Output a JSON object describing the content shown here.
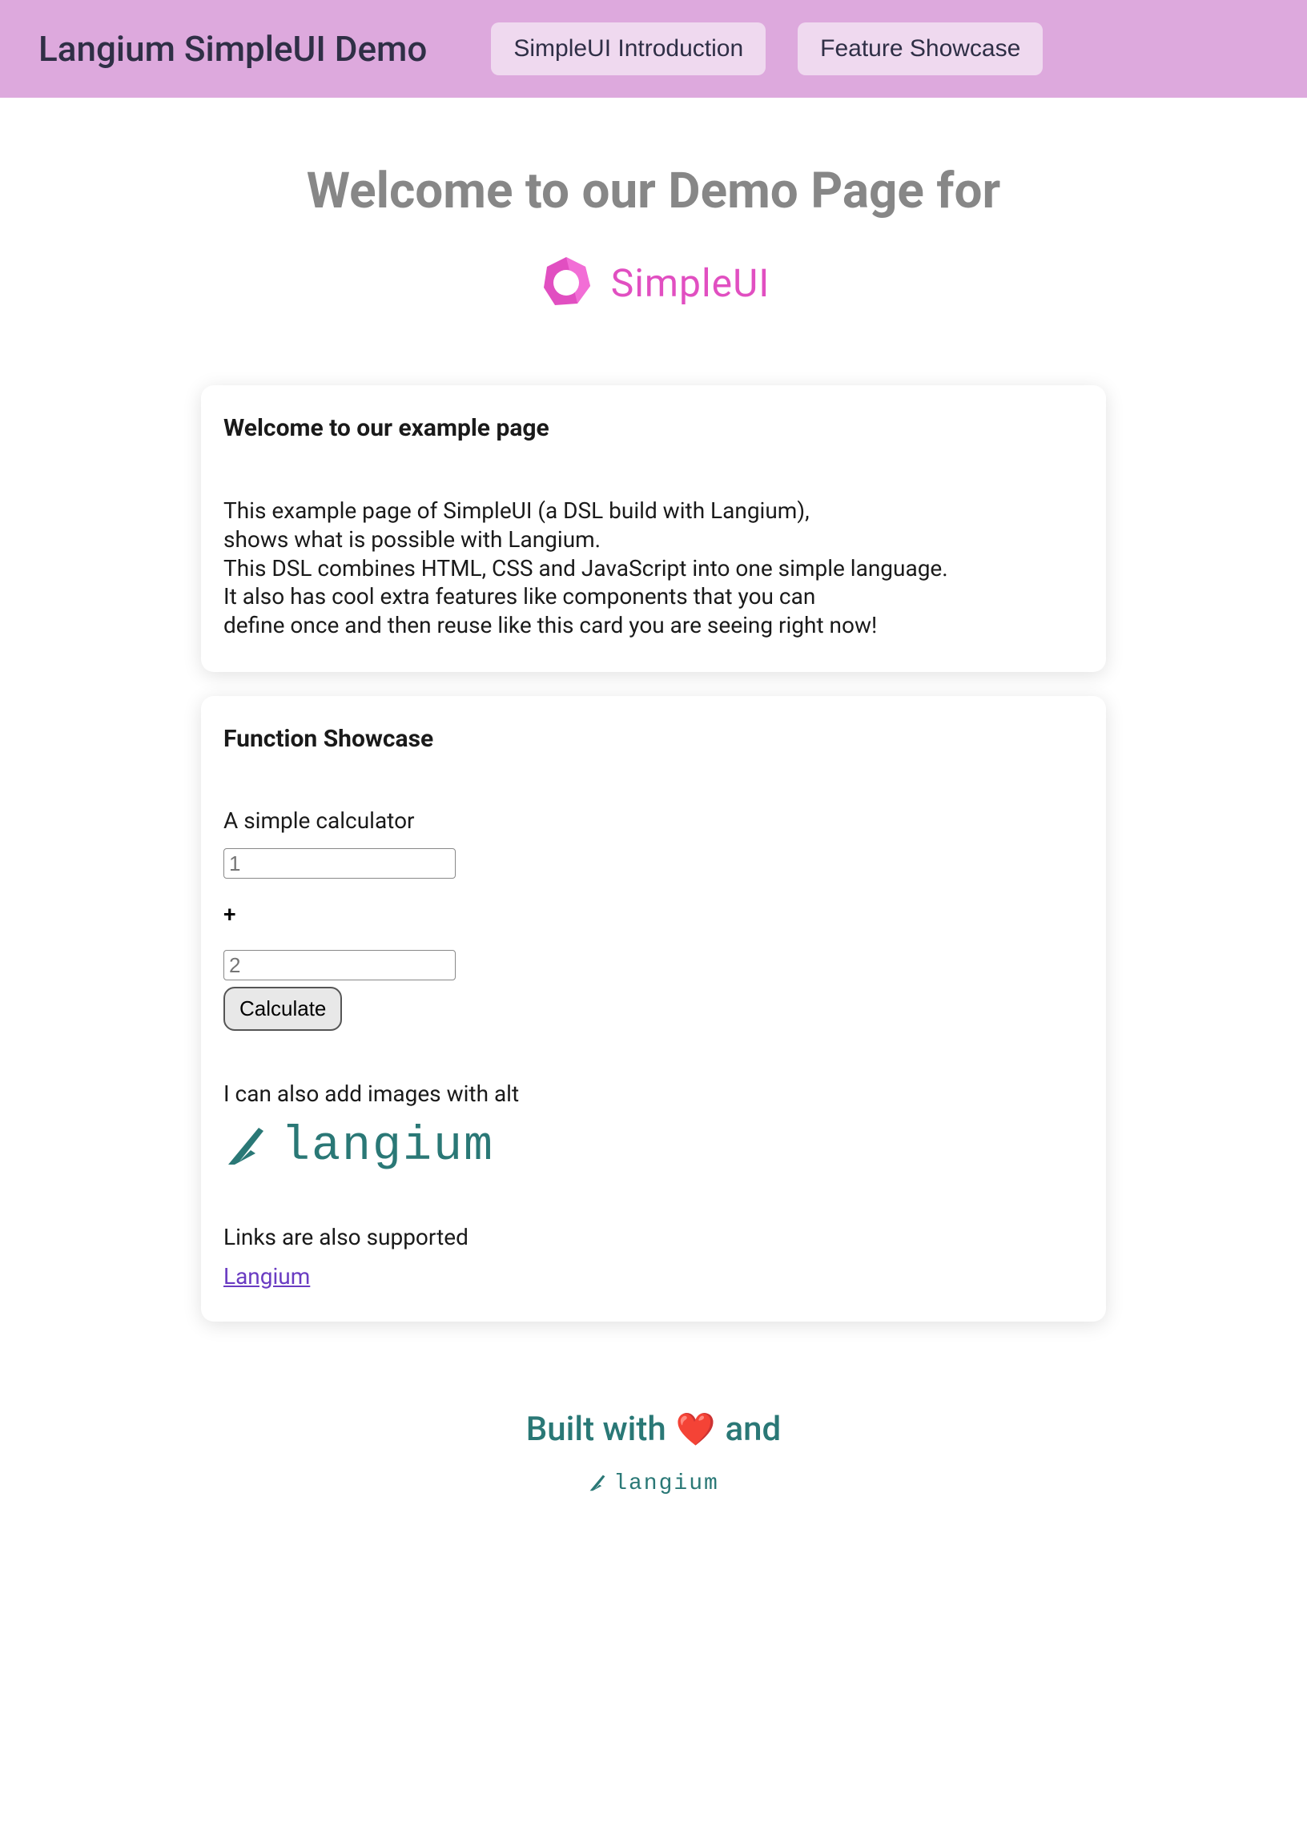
{
  "topbar": {
    "title": "Langium SimpleUI Demo",
    "tabs": [
      {
        "label": "SimpleUI Introduction"
      },
      {
        "label": "Feature Showcase"
      }
    ]
  },
  "hero": {
    "title": "Welcome to our Demo Page for",
    "logo_text": "SimpleUI"
  },
  "card1": {
    "title": "Welcome to our example page",
    "body": "This example page of SimpleUI (a DSL build with Langium),\nshows what is possible with Langium.\nThis DSL combines HTML, CSS and JavaScript into one simple language.\nIt also has cool extra features like components that you can\ndefine once and then reuse like this card you are seeing right now!"
  },
  "card2": {
    "title": "Function Showcase",
    "calc_label": "A simple calculator",
    "input1_placeholder": "1",
    "plus": "+",
    "input2_placeholder": "2",
    "button_label": "Calculate",
    "images_text": "I can also add images with alt",
    "langium_logo_text": "langium",
    "links_text": "Links are also supported",
    "link_label": "Langium"
  },
  "footer": {
    "built_with": "Built with",
    "and": "and",
    "logo_text": "langium"
  }
}
